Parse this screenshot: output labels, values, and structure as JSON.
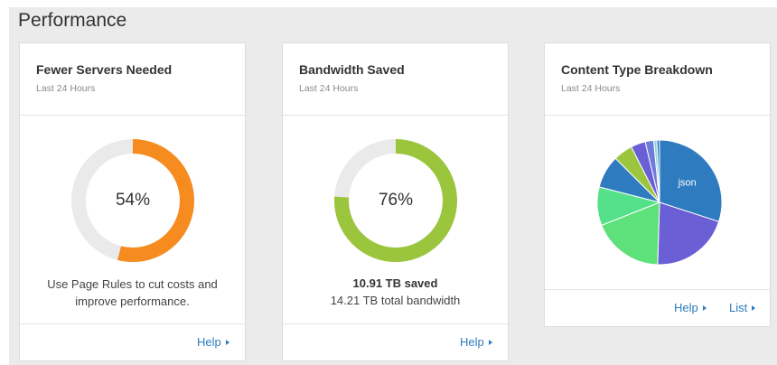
{
  "section": {
    "title": "Performance"
  },
  "cards": {
    "servers": {
      "title": "Fewer Servers Needed",
      "subtitle": "Last 24 Hours",
      "percent_label": "54%",
      "percent_value": 54,
      "ring_color": "#f68b1f",
      "track_color": "#eaeaea",
      "message_line1": "Use Page Rules to cut costs and",
      "message_line2": "improve performance.",
      "help_label": "Help"
    },
    "bandwidth": {
      "title": "Bandwidth Saved",
      "subtitle": "Last 24 Hours",
      "percent_label": "76%",
      "percent_value": 76,
      "ring_color": "#9bc53d",
      "track_color": "#eaeaea",
      "saved_label": "10.91 TB saved",
      "total_label": "14.21 TB total bandwidth",
      "help_label": "Help"
    },
    "content_type": {
      "title": "Content Type Breakdown",
      "subtitle": "Last 24 Hours",
      "help_label": "Help",
      "list_label": "List",
      "icons": {
        "link_arrow": "caret-right-icon"
      }
    }
  },
  "chart_data": {
    "type": "pie",
    "slices": [
      {
        "label": "json",
        "value": 30.0,
        "color": "#2f7bbf"
      },
      {
        "value": 20.5,
        "color": "#6b5fd6"
      },
      {
        "value": 18.5,
        "color": "#5ee07a"
      },
      {
        "value": 10.0,
        "color": "#55e08a"
      },
      {
        "value": 8.5,
        "color": "#2f7bbf"
      },
      {
        "value": 5.0,
        "color": "#9bc53d"
      },
      {
        "value": 3.8,
        "color": "#6b5fd6"
      },
      {
        "value": 2.2,
        "color": "#6f7bd8"
      },
      {
        "value": 0.8,
        "color": "#8ad6e0"
      },
      {
        "value": 0.7,
        "color": "#2f7bbf"
      }
    ]
  }
}
